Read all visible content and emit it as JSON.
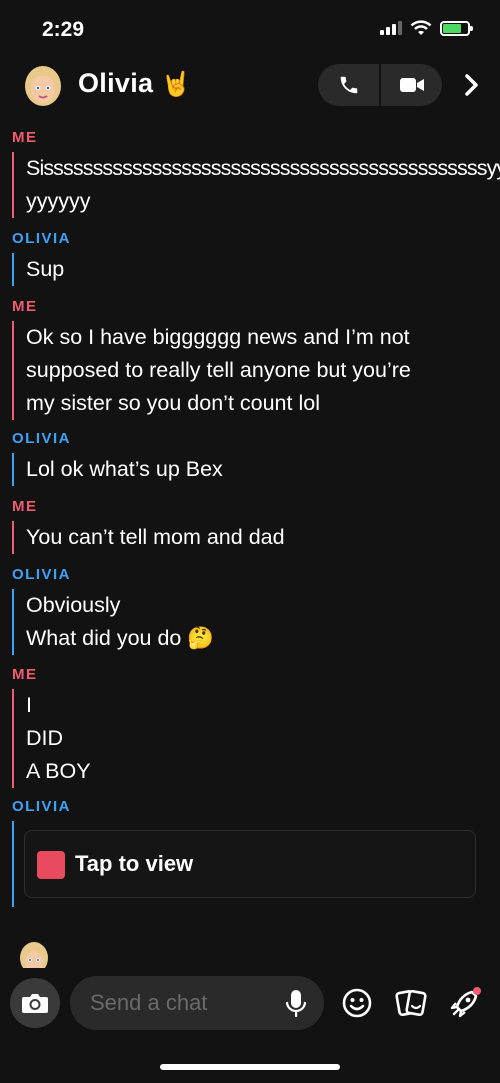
{
  "status_bar": {
    "time": "2:29"
  },
  "header": {
    "name": "Olivia",
    "emoji": "🤘"
  },
  "messages": [
    {
      "sender": "ME",
      "lines": [
        "Sisssssssssssssssssssssssssssssssssssssssssssssyy",
        "yyyyyy"
      ]
    },
    {
      "sender": "OLIVIA",
      "lines": [
        "Sup"
      ]
    },
    {
      "sender": "ME",
      "lines": [
        "Ok so I have bigggggg news and I’m not",
        "supposed to really tell anyone but you’re",
        "my sister so you don’t count lol"
      ]
    },
    {
      "sender": "OLIVIA",
      "lines": [
        "Lol ok what’s up Bex"
      ]
    },
    {
      "sender": "ME",
      "lines": [
        "You can’t tell mom and dad"
      ]
    },
    {
      "sender": "OLIVIA",
      "lines": [
        "Obviously",
        "What did you do 🤔"
      ]
    },
    {
      "sender": "ME",
      "lines": [
        "I",
        "DID",
        "A BOY"
      ]
    },
    {
      "sender": "OLIVIA",
      "snap_label": "Tap to view"
    }
  ],
  "input": {
    "placeholder": "Send a chat"
  },
  "icons": {
    "call": "phone-icon",
    "video": "video-camera-icon",
    "chevron": "chevron-right-icon",
    "camera": "camera-icon",
    "mic": "microphone-icon",
    "emoji": "smiley-icon",
    "stickers": "sticker-cards-icon",
    "games": "rocket-icon"
  },
  "colors": {
    "me": "#f25c6e",
    "olivia": "#3fa2f7",
    "snap": "#e84a5f",
    "background": "#121212"
  }
}
